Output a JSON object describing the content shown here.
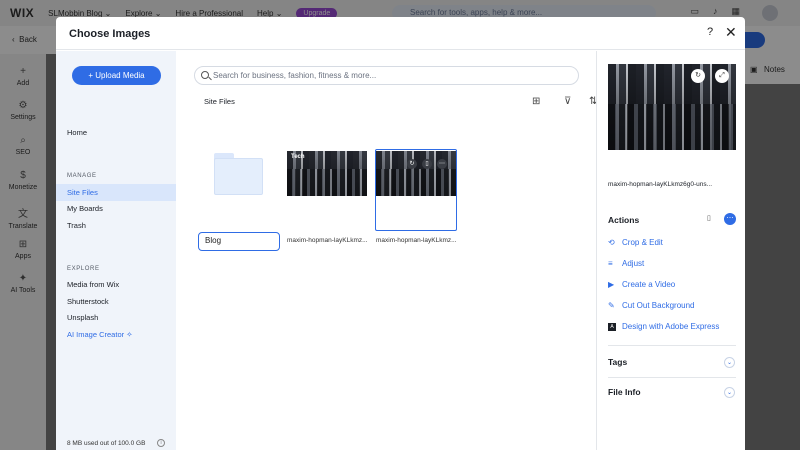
{
  "editor": {
    "logo": "WIX",
    "site_name": "SLMobbin Blog ⌄",
    "menu": [
      "Explore ⌄",
      "Hire a Professional",
      "Help ⌄"
    ],
    "upgrade": "Upgrade",
    "search_placeholder": "Search for tools, apps, help & more...",
    "back": "Back",
    "notes": "Notes",
    "rail": [
      {
        "label": "Add",
        "icon": "+"
      },
      {
        "label": "Settings",
        "icon": "⚙"
      },
      {
        "label": "SEO",
        "icon": "⌕"
      },
      {
        "label": "Monetize",
        "icon": "$"
      },
      {
        "label": "Translate",
        "icon": "文"
      },
      {
        "label": "Apps",
        "icon": "⊞"
      },
      {
        "label": "AI Tools",
        "icon": "✦"
      }
    ]
  },
  "modal": {
    "title": "Choose Images",
    "help": "?",
    "close": "✕"
  },
  "sidebar": {
    "upload": "+ Upload Media",
    "home": "Home",
    "manage_title": "MANAGE",
    "manage": [
      "Site Files",
      "My Boards",
      "Trash"
    ],
    "explore_title": "EXPLORE",
    "explore": [
      "Media from Wix",
      "Shutterstock",
      "Unsplash",
      "AI Image Creator"
    ],
    "storage": "8 MB used out of 100.0 GB"
  },
  "main": {
    "search_placeholder": "Search for business, fashion, fitness & more...",
    "breadcrumb": "Site Files",
    "folder_name": "Blog",
    "files": [
      {
        "caption": "maxim-hopman-layKLkmz...",
        "label": "Tech"
      },
      {
        "caption": "maxim-hopman-layKLkmz..."
      }
    ]
  },
  "panel": {
    "file_name": "maxim-hopman-layKLkmz6g0-uns...",
    "actions_title": "Actions",
    "actions": [
      "Crop & Edit",
      "Adjust",
      "Create a Video",
      "Cut Out Background",
      "Design with Adobe Express"
    ],
    "tags": "Tags",
    "file_info": "File Info"
  },
  "colors": {
    "accent": "#2f6ce5",
    "upgrade": "#9a4cd6",
    "sidebar_bg": "#f0f4fa"
  }
}
